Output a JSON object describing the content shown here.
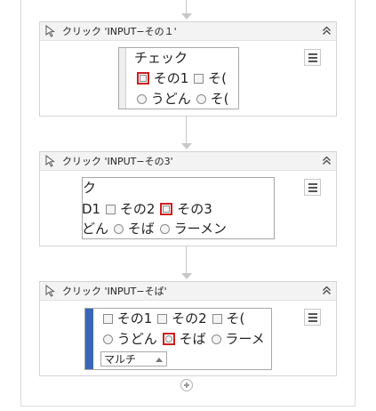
{
  "workflow": {
    "activities": [
      {
        "title": "クリック 'INPUT−その１'",
        "screenshot": {
          "line1": "チェック",
          "line2": [
            "その1",
            "そ("
          ],
          "line3": [
            "うどん",
            "そ("
          ]
        }
      },
      {
        "title": "クリック 'INPUT−その3'",
        "screenshot": {
          "line1": "ク",
          "line2": [
            "D1",
            "その2",
            "その3"
          ],
          "line3": [
            "どん",
            "そば",
            "ラーメン"
          ]
        }
      },
      {
        "title": "クリック 'INPUT−そば'",
        "screenshot": {
          "line1": [
            "その1",
            "その2",
            "そ("
          ],
          "line2": [
            "うどん",
            "そば",
            "ラーメ"
          ],
          "select_value": "マルチ"
        }
      }
    ]
  },
  "icons": {
    "activity_icon": "cursor-icon",
    "collapse_icon": "double-chevron-up-icon",
    "menu_icon": "hamburger-menu-icon",
    "add_icon": "plus-circle-icon"
  },
  "colors": {
    "highlight": "#cc1f1f",
    "selection_bar": "#3a66b8",
    "header_bg": "#f3f3f3"
  }
}
